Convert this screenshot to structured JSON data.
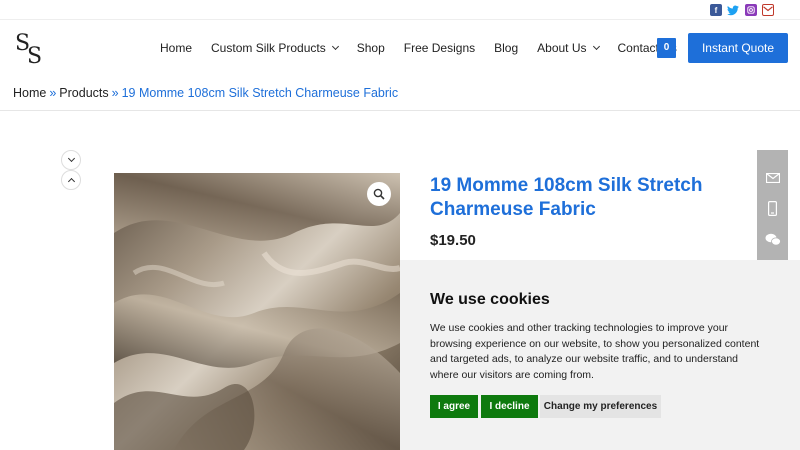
{
  "social": {
    "facebook_icon": "facebook-icon",
    "twitter_icon": "twitter-icon",
    "instagram_icon": "instagram-icon",
    "mail_icon": "mail-icon"
  },
  "header": {
    "logo_text": "SS",
    "nav": [
      {
        "label": "Home",
        "dropdown": false
      },
      {
        "label": "Custom Silk Products",
        "dropdown": true
      },
      {
        "label": "Shop",
        "dropdown": false
      },
      {
        "label": "Free Designs",
        "dropdown": false
      },
      {
        "label": "Blog",
        "dropdown": false
      },
      {
        "label": "About Us",
        "dropdown": true
      },
      {
        "label": "Contact Us",
        "dropdown": false
      }
    ],
    "cart_count": "0",
    "quote_label": "Instant Quote"
  },
  "breadcrumb": {
    "home": "Home",
    "sep1": "»",
    "products": "Products",
    "sep2": "»",
    "current": "19 Momme 108cm Silk Stretch Charmeuse Fabric"
  },
  "product": {
    "title": "19 Momme 108cm Silk Stretch Charmeuse Fabric",
    "price": "$19.50"
  },
  "cookie": {
    "title": "We use cookies",
    "text": "We use cookies and other tracking technologies to improve your browsing experience on our website, to show you personalized content and targeted ads, to analyze our website traffic, and to understand where our visitors are coming from.",
    "agree_label": "I agree",
    "decline_label": "I decline",
    "prefs_label": "Change my preferences"
  },
  "colors": {
    "brand_blue": "#1e6fd9",
    "cookie_green": "#0e7a0e",
    "side_widget_gray": "#b3b3b3"
  }
}
